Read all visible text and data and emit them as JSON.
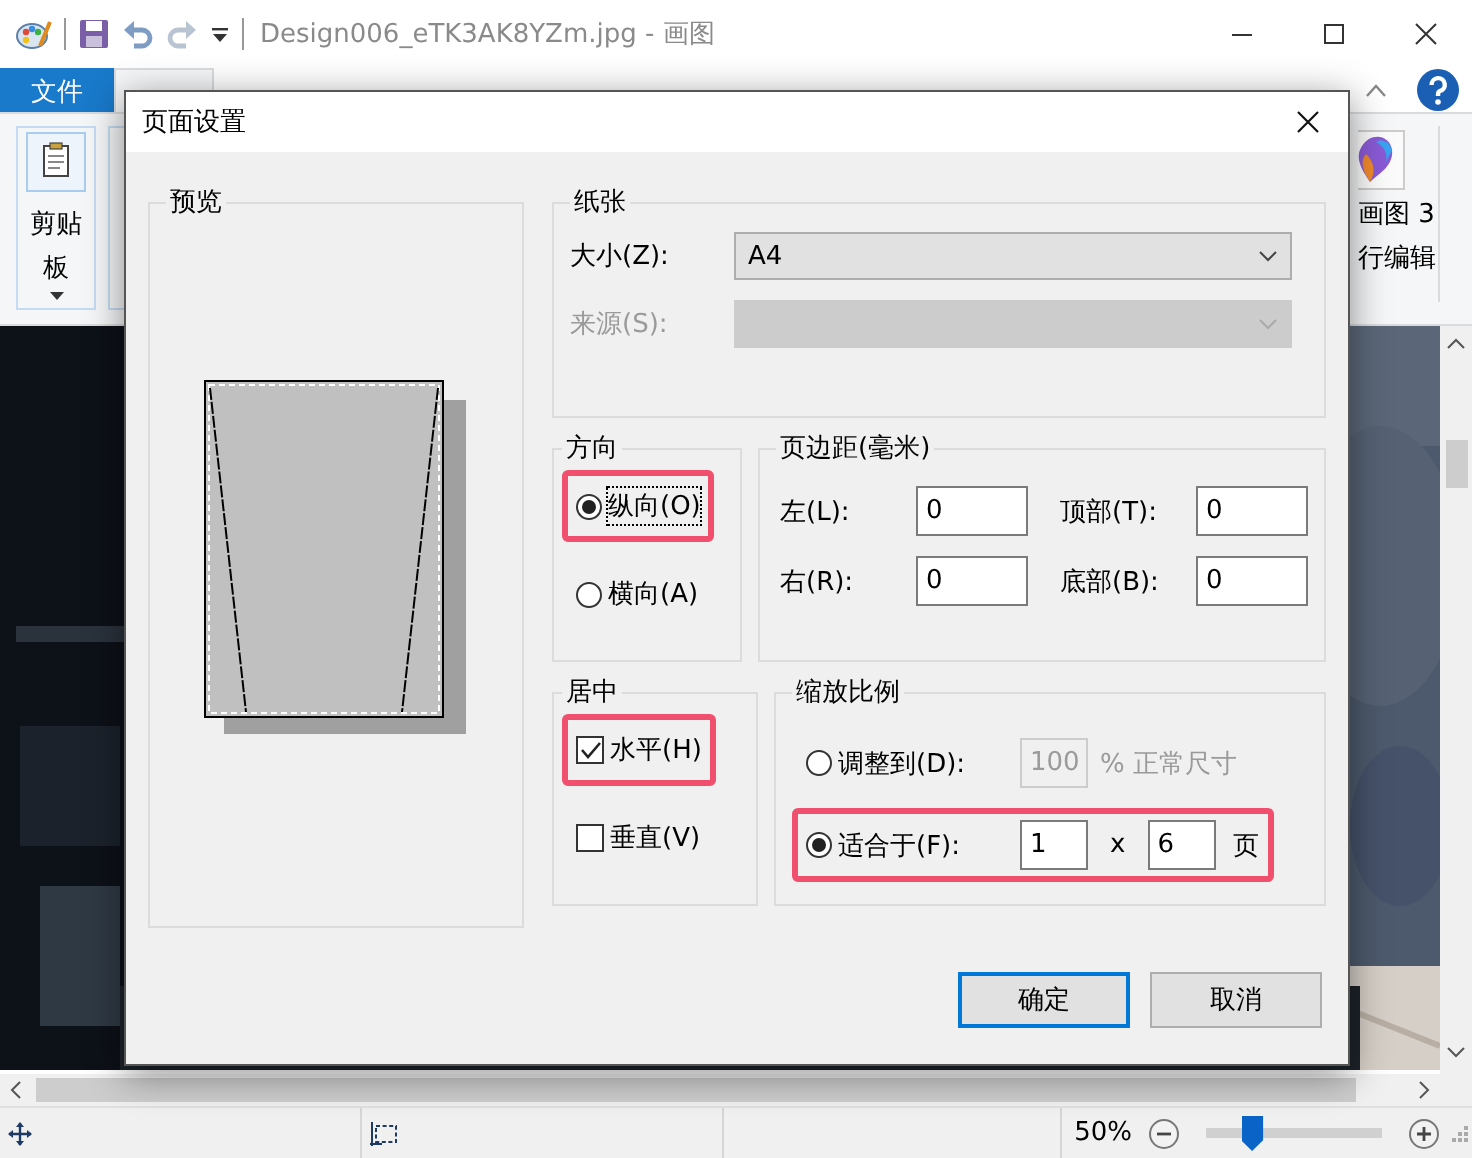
{
  "window": {
    "title": "Design006_eTK3AK8YZm.jpg - 画图"
  },
  "ribbon_tabs": [
    {
      "label": "文件",
      "kind": "file",
      "selected": false
    }
  ],
  "ribbon": {
    "clipboard_label": "剪贴板",
    "paint3d_lines": [
      "画图 3",
      "行编辑"
    ]
  },
  "dialog": {
    "title": "页面设置",
    "preview": {
      "title": "预览"
    },
    "paper": {
      "title": "纸张",
      "size_label": "大小(Z):",
      "size_value": "A4",
      "source_label": "来源(S):",
      "source_disabled": true
    },
    "orientation": {
      "title": "方向",
      "options": [
        {
          "label": "纵向(O)",
          "selected": true,
          "highlighted": true
        },
        {
          "label": "横向(A)",
          "selected": false,
          "highlighted": false
        }
      ]
    },
    "margins": {
      "title": "页边距(毫米)",
      "fields": [
        {
          "label": "左(L):",
          "value": "0"
        },
        {
          "label": "顶部(T):",
          "value": "0"
        },
        {
          "label": "右(R):",
          "value": "0"
        },
        {
          "label": "底部(B):",
          "value": "0"
        }
      ]
    },
    "centering": {
      "title": "居中",
      "options": [
        {
          "label": "水平(H)",
          "checked": true,
          "highlighted": true
        },
        {
          "label": "垂直(V)",
          "checked": false,
          "highlighted": false
        }
      ]
    },
    "scaling": {
      "title": "缩放比例",
      "adjust": {
        "label": "调整到(D):",
        "selected": false,
        "value": "100",
        "suffix": "% 正常尺寸",
        "disabled": true
      },
      "fit": {
        "label": "适合于(F):",
        "selected": true,
        "highlighted": true,
        "wide": "1",
        "separator": "x",
        "tall": "6",
        "unit": "页"
      }
    },
    "buttons": [
      {
        "label": "确定",
        "default": true
      },
      {
        "label": "取消",
        "default": false
      }
    ]
  },
  "status_bar": {
    "zoom": "50%",
    "zoom_slider": {
      "level": 0.24
    }
  }
}
